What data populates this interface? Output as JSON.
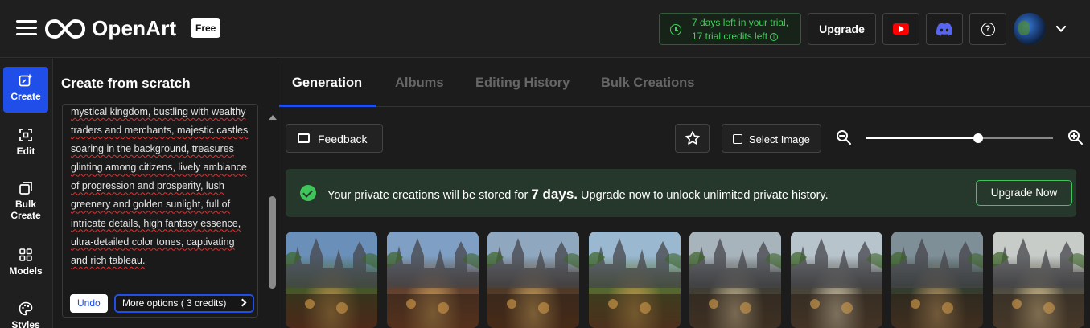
{
  "header": {
    "logo_text": "OpenArt",
    "plan_badge": "Free",
    "trial_line1": "7 days left in your trial,",
    "trial_line2": "17 trial credits left",
    "upgrade_label": "Upgrade",
    "help_glyph": "?",
    "icons": [
      "menu-icon",
      "openart-logo-icon",
      "clock-icon",
      "info-icon",
      "youtube-icon",
      "discord-icon",
      "help-icon",
      "chevron-down-icon"
    ]
  },
  "rail": {
    "items": [
      {
        "label": "Create",
        "icon": "sparkle-edit-icon"
      },
      {
        "label": "Edit",
        "icon": "edit-frame-icon"
      },
      {
        "label": "Bulk Create",
        "icon": "stack-icon"
      },
      {
        "label": "Models",
        "icon": "grid-icon"
      },
      {
        "label": "Styles",
        "icon": "palette-icon"
      }
    ]
  },
  "panel": {
    "title": "Create from scratch",
    "prompt_text": "mystical kingdom, bustling with wealthy traders and merchants, majestic castles soaring in the background, treasures glinting among citizens, lively ambiance of progression and prosperity, lush greenery and golden sunlight, full of intricate details, high fantasy essence, ultra-detailed color tones, captivating and rich tableau.",
    "undo_label": "Undo",
    "more_options_label": "More options ( 3 credits)"
  },
  "main": {
    "tabs": [
      {
        "label": "Generation",
        "active": true
      },
      {
        "label": "Albums",
        "active": false
      },
      {
        "label": "Editing History",
        "active": false
      },
      {
        "label": "Bulk Creations",
        "active": false
      }
    ],
    "feedback_label": "Feedback",
    "select_image_label": "Select Image",
    "zoom_level": 0.6,
    "banner": {
      "text_before": "Your private creations will be stored for ",
      "text_bold": "7 days.",
      "text_after": " Upgrade now to unlock unlimited private history.",
      "button_label": "Upgrade Now"
    },
    "thumbnail_count": 8
  },
  "colors": {
    "accent_blue": "#1f4ee8",
    "success_green": "#3fc55a",
    "trial_green": "#3fd15b",
    "banner_bg": "#26382b",
    "youtube_red": "#ff0000",
    "discord_blue": "#5865f2"
  }
}
